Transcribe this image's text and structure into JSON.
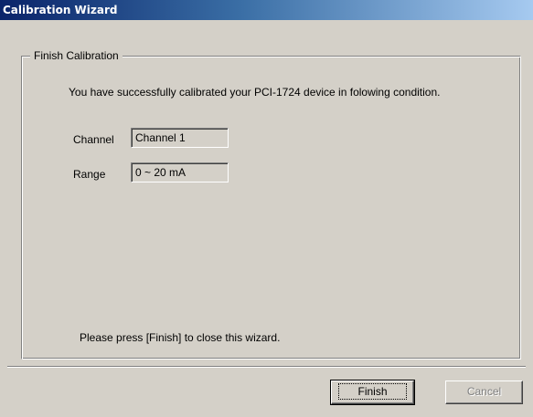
{
  "window": {
    "title": "Calibration Wizard"
  },
  "group": {
    "legend": "Finish Calibration"
  },
  "message": {
    "success": "You have successfully calibrated your PCI-1724 device in folowing condition.",
    "close_hint": "Please press [Finish] to close this wizard."
  },
  "fields": {
    "channel_label": "Channel",
    "channel_value": "Channel 1",
    "range_label": "Range",
    "range_value": "0 ~ 20 mA"
  },
  "buttons": {
    "finish_label": "Finish",
    "cancel_label": "Cancel"
  },
  "colors": {
    "face": "#d4d0c8",
    "title_start": "#0a246a",
    "title_end": "#a6caf0"
  }
}
